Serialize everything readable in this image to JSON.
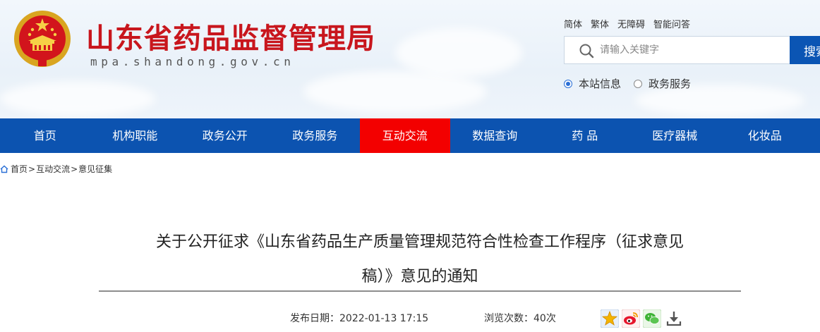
{
  "header": {
    "title": "山东省药品监督管理局",
    "domain": "mpa.shandong.gov.cn",
    "emblem_icon": "national-emblem-icon",
    "links": [
      "简体",
      "繁体",
      "无障碍",
      "智能问答"
    ]
  },
  "search": {
    "placeholder": "请输入关键字",
    "button_label": "搜索",
    "options": [
      {
        "label": "本站信息",
        "selected": true
      },
      {
        "label": "政务服务",
        "selected": false
      }
    ]
  },
  "nav": {
    "items": [
      "首页",
      "机构职能",
      "政务公开",
      "政务服务",
      "互动交流",
      "数据查询",
      "药 品",
      "医疗器械",
      "化妆品"
    ],
    "active": "互动交流"
  },
  "breadcrumb": {
    "items": [
      "首页",
      "互动交流",
      "意见征集"
    ],
    "separator": ">"
  },
  "article": {
    "title_line1": "关于公开征求《山东省药品生产质量管理规范符合性检查工作程序（征求意见",
    "title_line2": "稿）》意见的通知",
    "date_label": "发布日期：",
    "date": "2022-01-13 17:15",
    "views_label": "浏览次数：",
    "views": "40次"
  },
  "share": {
    "icons": [
      "qzone-star-icon",
      "weibo-icon",
      "wechat-icon",
      "download-icon"
    ]
  },
  "colors": {
    "brand_red": "#c8161d",
    "nav_blue": "#0c53b0",
    "nav_active": "#f30000",
    "search_blue": "#0b55b4"
  }
}
